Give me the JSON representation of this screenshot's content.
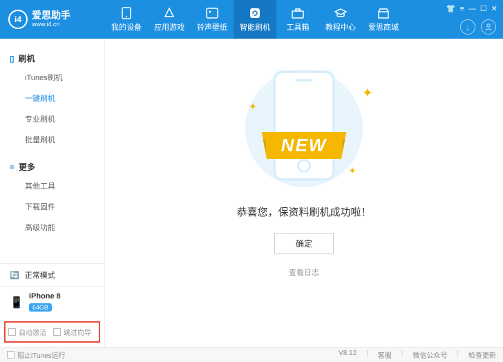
{
  "app": {
    "name": "爱思助手",
    "url": "www.i4.cn",
    "version": "V8.12"
  },
  "nav": {
    "items": [
      {
        "label": "我的设备"
      },
      {
        "label": "应用游戏"
      },
      {
        "label": "铃声壁纸"
      },
      {
        "label": "智能刷机"
      },
      {
        "label": "工具箱"
      },
      {
        "label": "教程中心"
      },
      {
        "label": "爱思商城"
      }
    ]
  },
  "sidebar": {
    "group1": {
      "title": "刷机",
      "items": [
        "iTunes刷机",
        "一键刷机",
        "专业刷机",
        "批量刷机"
      ]
    },
    "group2": {
      "title": "更多",
      "items": [
        "其他工具",
        "下载固件",
        "高级功能"
      ]
    },
    "status": "正常模式",
    "device": {
      "name": "iPhone 8",
      "badge": "64GB"
    },
    "checks": {
      "c1": "自动激活",
      "c2": "跳过向导"
    }
  },
  "main": {
    "ribbon": "NEW",
    "message": "恭喜您，保资料刷机成功啦！",
    "ok_label": "确定",
    "log_label": "查看日志"
  },
  "footer": {
    "block_itunes": "阻止iTunes运行",
    "links": [
      "客服",
      "微信公众号",
      "检查更新"
    ]
  }
}
